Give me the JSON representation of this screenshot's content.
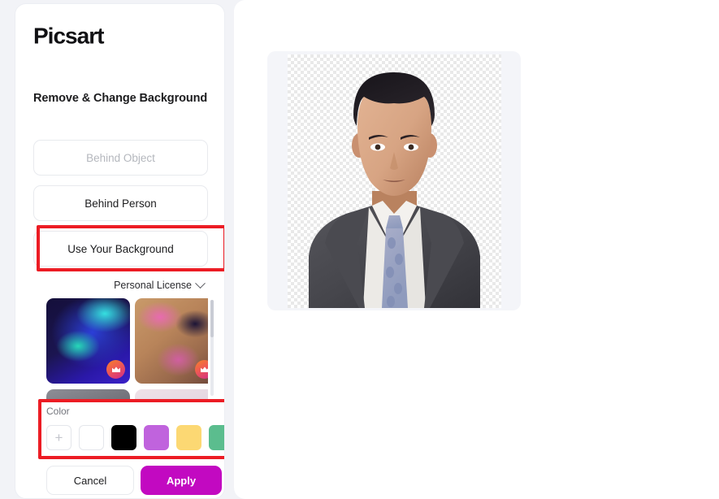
{
  "brand": {
    "name": "Picsart",
    "logo_icon": "picsart-wordmark"
  },
  "panel": {
    "title": "Remove & Change Background",
    "options": [
      {
        "label": "Behind Object",
        "state": "disabled"
      },
      {
        "label": "Behind Person",
        "state": "default"
      },
      {
        "label": "Use Your Background",
        "state": "highlighted"
      }
    ],
    "license": {
      "label": "Personal License",
      "icon": "chevron-down-icon"
    },
    "backgrounds": [
      {
        "name": "blue-teal-gradient",
        "premium": true,
        "badge_icon": "crown-icon"
      },
      {
        "name": "tan-pink-swirl-gradient",
        "premium": true,
        "badge_icon": "crown-icon"
      },
      {
        "name": "gray-gradient",
        "premium": false,
        "badge_icon": ""
      },
      {
        "name": "pink-pearl-gradient",
        "premium": false,
        "badge_icon": ""
      }
    ],
    "color_section": {
      "label": "Color",
      "add_icon": "plus-icon",
      "swatches": [
        {
          "name": "add-color",
          "hex": ""
        },
        {
          "name": "white",
          "hex": "#ffffff"
        },
        {
          "name": "black",
          "hex": "#000000"
        },
        {
          "name": "orchid",
          "hex": "#c063dd"
        },
        {
          "name": "yellow",
          "hex": "#fcd873"
        },
        {
          "name": "green",
          "hex": "#5bbd8e"
        }
      ]
    },
    "footer": {
      "cancel_label": "Cancel",
      "apply_label": "Apply",
      "apply_color": "#c209c1"
    }
  },
  "canvas": {
    "image_name": "portrait-man-in-suit",
    "background": "transparent-checkerboard"
  },
  "annotations": {
    "highlight_color": "#ec1c24",
    "boxes": [
      {
        "target": "use-your-background-button"
      },
      {
        "target": "color-swatch-section"
      }
    ]
  }
}
